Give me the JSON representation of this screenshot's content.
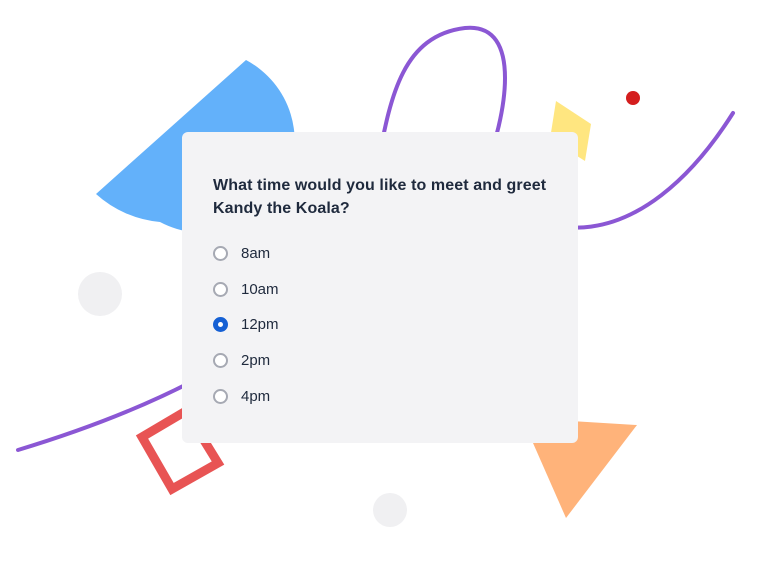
{
  "question": "What time would you like to meet and greet Kandy the Koala?",
  "options": [
    {
      "label": "8am",
      "selected": false
    },
    {
      "label": "10am",
      "selected": false
    },
    {
      "label": "12pm",
      "selected": true
    },
    {
      "label": "2pm",
      "selected": false
    },
    {
      "label": "4pm",
      "selected": false
    }
  ],
  "colors": {
    "card_background": "#f3f3f5",
    "radio_selected": "#1560d4",
    "text": "#1f2a3d",
    "purple_line": "#8b57d4",
    "blue_shape": "#63b1fa",
    "yellow_shape": "#ffe680",
    "red_dot": "#d41e1e",
    "red_square": "#e85454",
    "orange_triangle": "#ffb37a",
    "gray_circle": "#f0f0f2"
  },
  "decorations": [
    "blue-semicircle-shape",
    "purple-loop-line",
    "yellow-parallelogram-shape",
    "red-dot-shape",
    "gray-circle-shape",
    "red-square-outline-shape",
    "orange-triangle-shape"
  ]
}
